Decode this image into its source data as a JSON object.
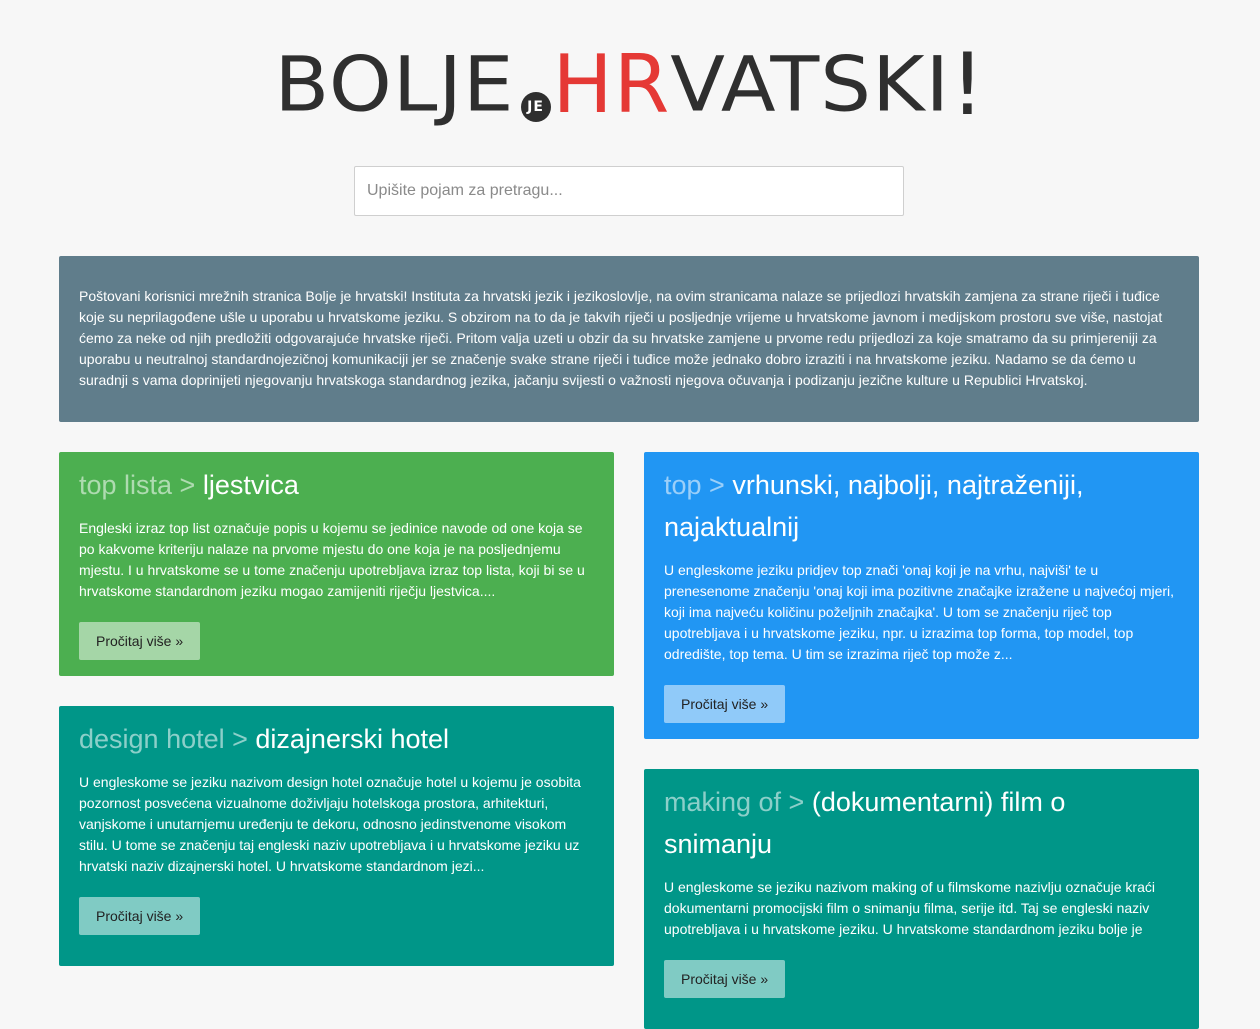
{
  "logo": {
    "part1": "BOLJE",
    "je": "JE",
    "part2": "HR",
    "part3": "VATSKI",
    "bang": "!"
  },
  "search": {
    "placeholder": "Upišite pojam za pretragu..."
  },
  "intro": {
    "text": "Poštovani korisnici mrežnih stranica Bolje je hrvatski! Instituta za hrvatski jezik i jezikoslovlje, na ovim stranicama nalaze se prijedlozi hrvatskih zamjena za strane riječi i tuđice koje su neprilagođene ušle u uporabu u hrvatskome jeziku. S obzirom na to da je takvih riječi u posljednje vrijeme u hrvatskome javnom i medijskom prostoru sve više, nastojat ćemo za neke od njih predložiti odgovarajuće hrvatske riječi. Pritom valja uzeti u obzir da su hrvatske zamjene u prvome redu prijedlozi za koje smatramo da su primjereniji za uporabu u neutralnoj standardnojezičnoj komunikaciji jer se značenje svake strane riječi i tuđice može jednako dobro izraziti i na hrvatskome jeziku. Nadamo se da ćemo u suradnji s vama doprinijeti njegovanju hrvatskoga standardnog jezika, jačanju svijesti o važnosti njegova očuvanja i podizanju jezične kulture u Republici Hrvatskoj."
  },
  "cards": [
    {
      "en": "top lista >",
      "hr": "ljestvica",
      "text": "Engleski izraz top list označuje popis u kojemu se jedinice navode od one koja se po kakvome kriteriju nalaze na prvome mjestu do one koja je na posljednjemu mjestu. I u hrvatskome se u tome značenju upotrebljava izraz top lista, koji bi se u hrvatskome standardnom jeziku mogao zamijeniti riječju ljestvica....",
      "button": "Pročitaj više »",
      "color": "#4caf50"
    },
    {
      "en": "top >",
      "hr": "vrhunski, najbolji, najtraženiji, najaktualnij",
      "text": "U engleskome jeziku pridjev top znači 'onaj koji je na vrhu, najviši' te u prenesenome značenju 'onaj koji ima pozitivne značajke izražene u najvećoj mjeri, koji ima najveću količinu poželjnih značajka'. U tom se značenju riječ top upotrebljava i u hrvatskome jeziku, npr. u izrazima top forma, top model, top odredište, top tema. U tim se izrazima riječ top može z...",
      "button": "Pročitaj više »",
      "color": "#2196f3"
    },
    {
      "en": "design hotel >",
      "hr": "dizajnerski hotel",
      "text": "U engleskome se jeziku nazivom design hotel označuje hotel u kojemu je osobita pozornost posvećena vizualnome doživljaju hotelskoga prostora, arhitekturi, vanjskome i unutarnjemu uređenju te dekoru, odnosno jedinstvenome visokom stilu. U tome se značenju taj engleski naziv upotrebljava i u hrvatskome jeziku uz hrvatski naziv dizajnerski hotel. U hrvatskome standardnom jezi...",
      "button": "Pročitaj više »",
      "color": "#009688"
    },
    {
      "en": "making of >",
      "hr": "(dokumentarni) film o snimanju",
      "text": "U engleskome se jeziku nazivom making of u filmskome nazivlju označuje kraći dokumentarni promocijski film o snimanju filma, serije itd. Taj se engleski naziv upotrebljava i u hrvatskome jeziku. U hrvatskome standardnom jeziku bolje je",
      "button": "Pročitaj više »",
      "color": "#009688"
    }
  ]
}
